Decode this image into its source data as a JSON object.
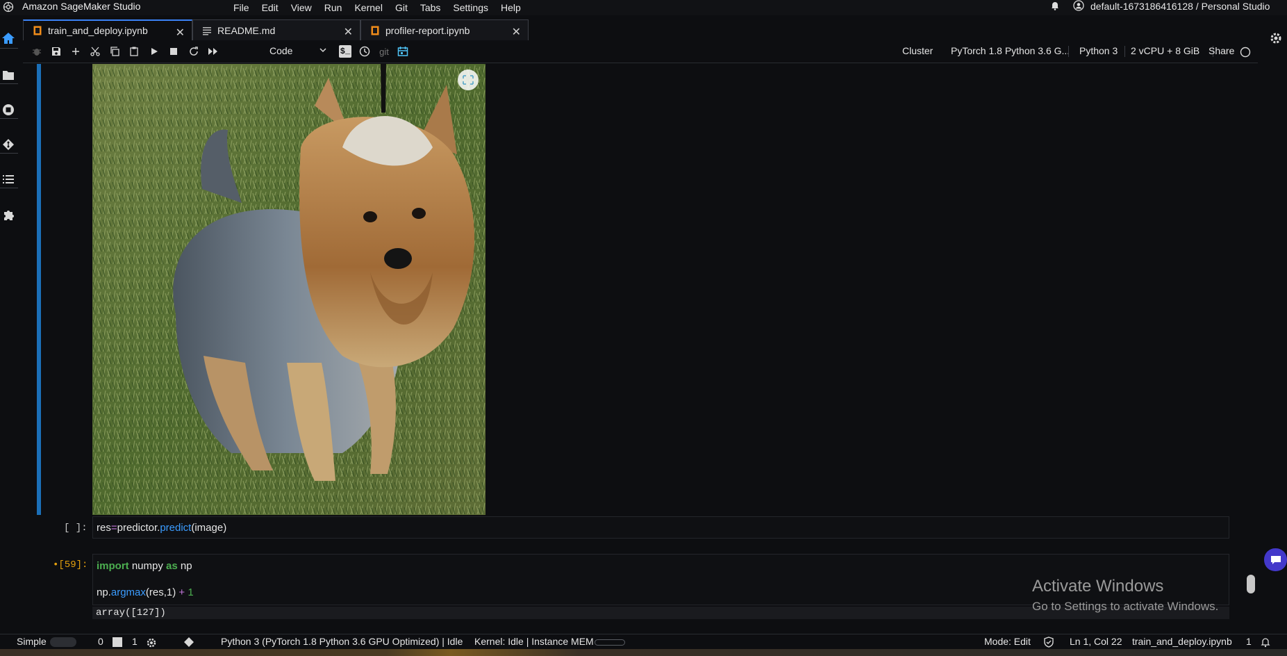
{
  "app": {
    "title": "Amazon SageMaker Studio",
    "user": "default-1673186416128 / Personal Studio"
  },
  "menu": [
    "File",
    "Edit",
    "View",
    "Run",
    "Kernel",
    "Git",
    "Tabs",
    "Settings",
    "Help"
  ],
  "tabs": [
    {
      "label": "train_and_deploy.ipynb",
      "icon": "notebook-icon",
      "active": true
    },
    {
      "label": "README.md",
      "icon": "markdown-icon",
      "active": false
    },
    {
      "label": "profiler-report.ipynb",
      "icon": "notebook-icon",
      "active": false
    }
  ],
  "toolbar": {
    "cell_type": "Code",
    "git": "git",
    "cluster": "Cluster",
    "image": "PyTorch 1.8 Python 3.6 G...",
    "kernel": "Python 3",
    "instance": "2 vCPU + 8 GiB",
    "share": "Share"
  },
  "cells": [
    {
      "prompt": "[ ]:",
      "code": [
        "res=predictor.predict(image)"
      ]
    },
    {
      "prompt": "•[59]:",
      "code": [
        "import numpy as np",
        "np.argmax(res,1) + 1"
      ],
      "output": "array([127])"
    }
  ],
  "watermark": {
    "line1": "Activate Windows",
    "line2": "Go to Settings to activate Windows."
  },
  "status": {
    "mode_label": "Simple",
    "count0": "0",
    "count1": "1",
    "kernel_info": "Python 3 (PyTorch 1.8 Python 3.6 GPU Optimized) | Idle",
    "kernel_state": "Kernel: Idle | Instance MEM",
    "mode": "Mode: Edit",
    "position": "Ln 1, Col 22",
    "file": "train_and_deploy.ipynb",
    "notifications": "1"
  },
  "colors": {
    "accent": "#3b82f6",
    "cell_bar": "#1b6fb8",
    "keyword": "#4caf50",
    "operator": "#c678dd",
    "function": "#3b9cff",
    "dirty": "#e5a00d"
  }
}
